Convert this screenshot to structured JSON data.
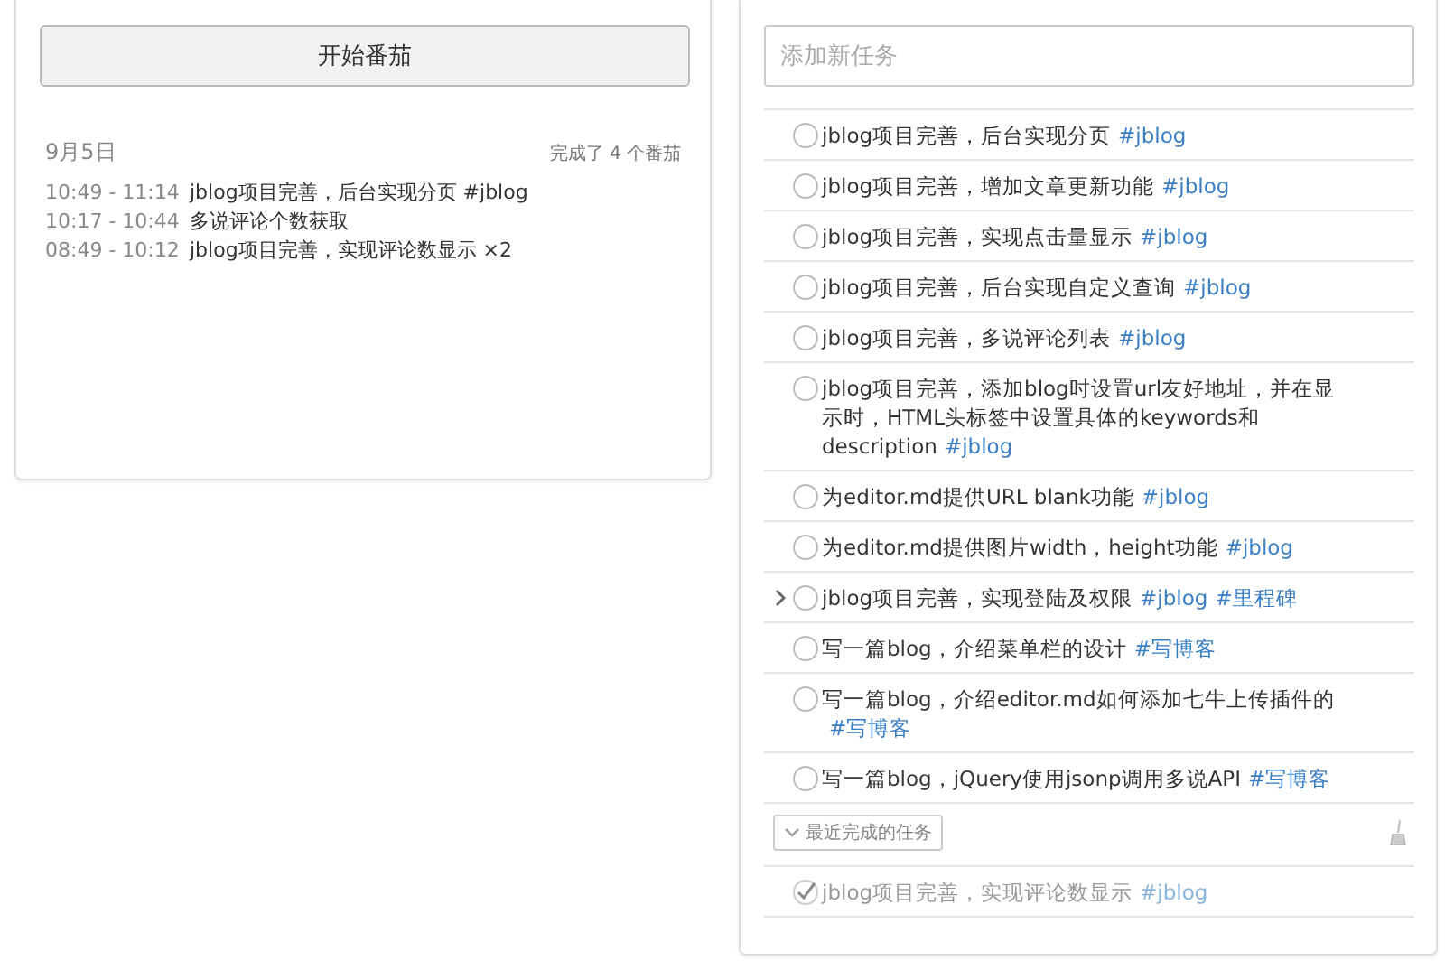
{
  "timer": {
    "start_button": "开始番茄"
  },
  "log": {
    "date": "9月5日",
    "summary": "完成了 4 个番茄",
    "entries": [
      {
        "time": "10:49 - 11:14",
        "text": "jblog项目完善，后台实现分页 #jblog"
      },
      {
        "time": "10:17 - 10:44",
        "text": "多说评论个数获取"
      },
      {
        "time": "08:49 - 10:12",
        "text": "jblog项目完善，实现评论数显示 ×2"
      }
    ]
  },
  "new_task": {
    "placeholder": "添加新任务"
  },
  "tasks": [
    {
      "text": "jblog项目完善，后台实现分页",
      "tags": [
        "#jblog"
      ],
      "checked": false,
      "expandable": false
    },
    {
      "text": "jblog项目完善，增加文章更新功能",
      "tags": [
        "#jblog"
      ],
      "checked": false,
      "expandable": false
    },
    {
      "text": "jblog项目完善，实现点击量显示",
      "tags": [
        "#jblog"
      ],
      "checked": false,
      "expandable": false
    },
    {
      "text": "jblog项目完善，后台实现自定义查询",
      "tags": [
        "#jblog"
      ],
      "checked": false,
      "expandable": false
    },
    {
      "text": "jblog项目完善，多说评论列表",
      "tags": [
        "#jblog"
      ],
      "checked": false,
      "expandable": false
    },
    {
      "text": "jblog项目完善，添加blog时设置url友好地址，并在显示时，HTML头标签中设置具体的keywords和description",
      "tags": [
        "#jblog"
      ],
      "checked": false,
      "expandable": false
    },
    {
      "text": "为editor.md提供URL blank功能",
      "tags": [
        "#jblog"
      ],
      "checked": false,
      "expandable": false
    },
    {
      "text": "为editor.md提供图片width，height功能",
      "tags": [
        "#jblog"
      ],
      "checked": false,
      "expandable": false
    },
    {
      "text": "jblog项目完善，实现登陆及权限",
      "tags": [
        "#jblog",
        "#里程碑"
      ],
      "checked": false,
      "expandable": true
    },
    {
      "text": "写一篇blog，介绍菜单栏的设计",
      "tags": [
        "#写博客"
      ],
      "checked": false,
      "expandable": false
    },
    {
      "text": "写一篇blog，介绍editor.md如何添加七牛上传插件的",
      "tags": [
        "#写博客"
      ],
      "checked": false,
      "expandable": false
    },
    {
      "text": "写一篇blog，jQuery使用jsonp调用多说API",
      "tags": [
        "#写博客"
      ],
      "checked": false,
      "expandable": false
    }
  ],
  "completed_toggle": {
    "label": "最近完成的任务"
  },
  "completed_tasks": [
    {
      "text": "jblog项目完善，实现评论数显示",
      "tags": [
        "#jblog"
      ],
      "checked": true,
      "expandable": false
    }
  ]
}
